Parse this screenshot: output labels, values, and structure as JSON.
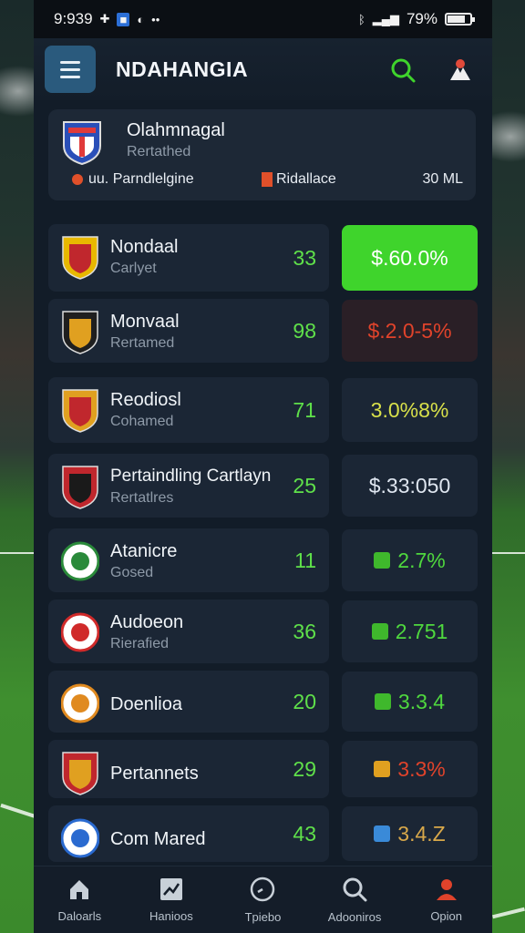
{
  "status": {
    "time": "9:939",
    "battery": "79%",
    "battery_level": 0.79
  },
  "appbar": {
    "title": "NDAHANGIA",
    "search_icon": "search-icon",
    "user_icon": "user-icon"
  },
  "featured": {
    "name": "Olahmnagal",
    "subtitle": "Rertathed",
    "meta_left": "Parndlelgine",
    "meta_left_prefix": "uu.",
    "meta_mid": "Ridallace",
    "size": "30 ML"
  },
  "rows": [
    {
      "name": "Nondaal",
      "subtitle": "Carlyet",
      "score": "33",
      "pct": "$.60.0%",
      "pct_style": "green-fill"
    },
    {
      "name": "Monvaal",
      "subtitle": "Rertamed",
      "score": "98",
      "pct": "$.2.0-5%",
      "pct_style": "red"
    },
    {
      "name": "Reodiosl",
      "subtitle": "Cohamed",
      "score": "71",
      "pct": "3.0%8%",
      "pct_style": "yellow"
    },
    {
      "name": "Pertaindling Cartlayn",
      "subtitle": "Rertatlres",
      "score": "25",
      "pct": "$.33:050",
      "pct_style": "white"
    },
    {
      "name": "Atanicre",
      "subtitle": "Gosed",
      "score": "11",
      "pct": "2.7%",
      "pct_style": "green"
    },
    {
      "name": "Audoeon",
      "subtitle": "Rierafied",
      "score": "36",
      "pct": "2.751",
      "pct_style": "green"
    },
    {
      "name": "Doenlioa",
      "subtitle": "",
      "score": "20",
      "pct": "3.3.4",
      "pct_style": "green"
    },
    {
      "name": "Pertannets",
      "subtitle": "",
      "score": "29",
      "pct": "3.3%",
      "pct_style": "orange"
    },
    {
      "name": "Com Mared",
      "subtitle": "",
      "score": "43",
      "pct": "3.4.Z",
      "pct_style": "blue"
    }
  ],
  "nav": [
    {
      "label": "Daloarls",
      "icon": "home-icon"
    },
    {
      "label": "Hanioos",
      "icon": "chart-icon"
    },
    {
      "label": "Tpiebo",
      "icon": "clock-icon"
    },
    {
      "label": "Adooniros",
      "icon": "search-icon"
    },
    {
      "label": "Opion",
      "icon": "profile-icon"
    }
  ],
  "colors": {
    "accent_green": "#3fd42c",
    "score_green": "#5fe04a",
    "down_red": "#e0432b",
    "bg": "#121c28"
  }
}
